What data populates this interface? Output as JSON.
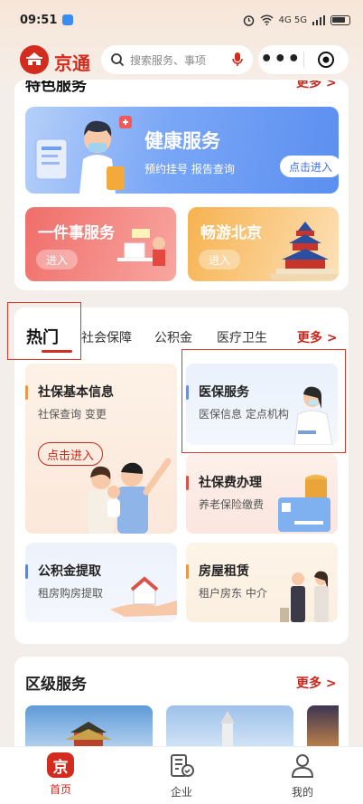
{
  "status_bar": {
    "time": "09:51",
    "network": "4G 5G"
  },
  "header": {
    "logo_text": "京通",
    "brand": "京通",
    "search_placeholder": "搜索服务、事项"
  },
  "featured": {
    "title": "特色服务",
    "more": "更多 >",
    "health": {
      "title": "健康服务",
      "subtitle": "预约挂号 报告查询",
      "button": "点击进入"
    },
    "one_thing": {
      "title": "一件事服务",
      "button": "进入"
    },
    "tour": {
      "title": "畅游北京",
      "button": "进入"
    }
  },
  "hot": {
    "tabs": [
      "热门",
      "社会保障",
      "公积金",
      "医疗卫生"
    ],
    "more": "更多 >",
    "items": [
      {
        "title": "社保基本信息",
        "subtitle": "社保查询 变更",
        "button": "点击进入"
      },
      {
        "title": "医保服务",
        "subtitle": "医保信息 定点机构"
      },
      {
        "title": "社保费办理",
        "subtitle": "养老保险缴费"
      },
      {
        "title": "公积金提取",
        "subtitle": "租房购房提取"
      },
      {
        "title": "房屋租赁",
        "subtitle": "租户房东 中介"
      }
    ]
  },
  "district": {
    "title": "区级服务",
    "more": "更多 >"
  },
  "tabbar": {
    "items": [
      "首页",
      "企业",
      "我的"
    ],
    "active": "首页",
    "home_icon_text": "京"
  },
  "colors": {
    "brand_red": "#d32b1e",
    "health_blue": "#5b8ff0"
  }
}
